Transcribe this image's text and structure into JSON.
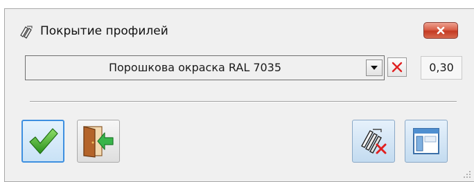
{
  "window": {
    "title": "Покрытие профилей",
    "title_icon": "paint-brush-icon",
    "close_icon": "close-icon"
  },
  "coating": {
    "selected": "Порошкова окраска RAL 7035",
    "dropdown_icon": "chevron-down-icon",
    "clear_icon": "red-x-icon",
    "thickness": "0,30"
  },
  "toolbar": {
    "ok_icon": "green-checkmark-icon",
    "exit_icon": "exit-door-icon",
    "remove_coating_icon": "remove-coating-icon",
    "layout_icon": "window-layout-icon"
  },
  "colors": {
    "window_bg": "#f0f0f0",
    "close_red": "#c43a22",
    "ok_green": "#3fae2a",
    "accent_blue": "#3d8fe0"
  }
}
